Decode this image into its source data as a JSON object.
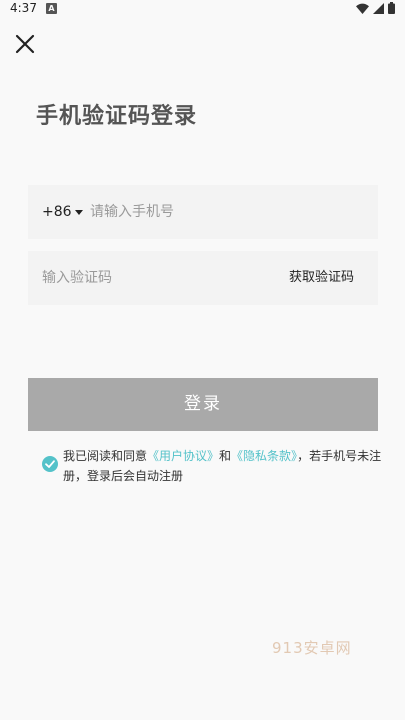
{
  "status_bar": {
    "time": "4:37",
    "notification_badge": "A",
    "icons": [
      "wifi-icon",
      "signal-icon",
      "battery-icon"
    ]
  },
  "header": {
    "close_icon": "close-icon",
    "title": "手机验证码登录"
  },
  "phone_field": {
    "country_code": "+86",
    "placeholder": "请输入手机号",
    "value": ""
  },
  "code_field": {
    "placeholder": "输入验证码",
    "value": "",
    "get_code_label": "获取验证码"
  },
  "login_button": {
    "label": "登录"
  },
  "agreement": {
    "checked": true,
    "prefix": "我已阅读和同意",
    "user_agreement": "《用户协议》",
    "and": "和",
    "privacy_policy": "《隐私条款》",
    "suffix": "，若手机号未注册，登录后会自动注册"
  },
  "watermark": "913安卓网",
  "colors": {
    "accent": "#54c2c9",
    "button_disabled": "#a9a9a9",
    "field_bg": "#f3f3f3",
    "background": "#f9f9f9"
  }
}
